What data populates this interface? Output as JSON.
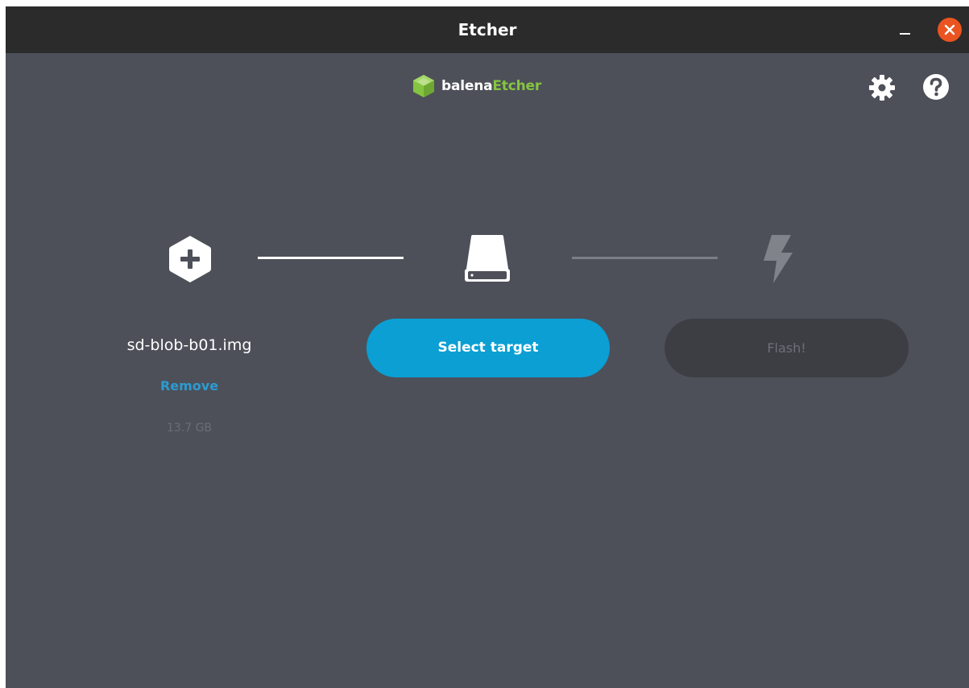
{
  "window": {
    "title": "Etcher"
  },
  "logo": {
    "prefix": "balena",
    "suffix": "Etcher"
  },
  "icons": {
    "settings": "gear-icon",
    "help": "question-mark-icon",
    "step_source": "plus-hexagon-icon",
    "step_target": "drive-icon",
    "step_flash": "lightning-bolt-icon",
    "minimize": "minimize-icon",
    "close": "close-icon"
  },
  "source": {
    "file_name": "sd-blob-b01.img",
    "remove_label": "Remove",
    "size": "13.7 GB"
  },
  "target": {
    "button_label": "Select target"
  },
  "flash": {
    "button_label": "Flash!"
  },
  "colors": {
    "background": "#4d5059",
    "titlebar": "#2b2b2b",
    "primary_button": "#0b9fd4",
    "disabled_button": "#3c3e44",
    "link": "#2c9bd1",
    "logo_accent": "#85c440",
    "close_button": "#e95420"
  }
}
